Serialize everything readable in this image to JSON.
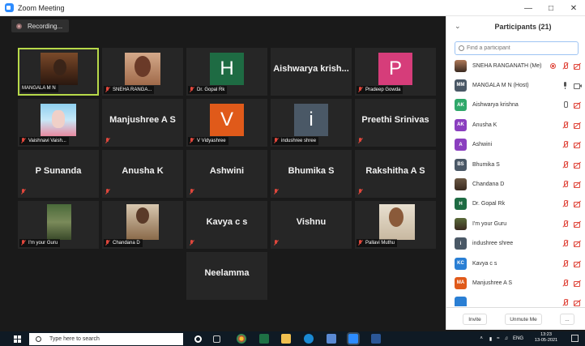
{
  "window": {
    "title": "Zoom Meeting",
    "controls": [
      "—",
      "□",
      "✕"
    ]
  },
  "recording": {
    "label": "Recording..."
  },
  "tiles": [
    {
      "id": "mangala",
      "name": "MANGALA M N",
      "type": "photo",
      "active": true,
      "muted": false
    },
    {
      "id": "sneha",
      "name": "SNEHA RANGA...",
      "type": "photo",
      "muted": true
    },
    {
      "id": "gopal",
      "name": "Dr. Gopal Rk",
      "type": "letter",
      "letter": "H",
      "color": "#1e6b43",
      "muted": true
    },
    {
      "id": "aishwarya",
      "big_name": "Aishwarya krish...",
      "type": "text",
      "muted": false
    },
    {
      "id": "pradeep",
      "name": "Pradeep Gowda",
      "type": "letter",
      "letter": "P",
      "color": "#d63d7a",
      "muted": true
    },
    {
      "id": "vaishnavi",
      "name": "Vaishnavi Vaish...",
      "type": "photo",
      "muted": true
    },
    {
      "id": "manjushree",
      "big_name": "Manjushree A S",
      "type": "text",
      "muted": true
    },
    {
      "id": "vidyashree",
      "name": "V Vidyashree",
      "type": "letter",
      "letter": "V",
      "color": "#e05a1a",
      "muted": true
    },
    {
      "id": "indushree",
      "name": "indushree shree",
      "type": "letter",
      "letter": "i",
      "color": "#4a5866",
      "muted": true
    },
    {
      "id": "preethi",
      "big_name": "Preethi Srinivas",
      "type": "text",
      "muted": true
    },
    {
      "id": "sunanda",
      "big_name": "P Sunanda",
      "type": "text",
      "muted": true
    },
    {
      "id": "anusha",
      "big_name": "Anusha K",
      "type": "text",
      "muted": true
    },
    {
      "id": "ashwini",
      "big_name": "Ashwini",
      "type": "text",
      "muted": true
    },
    {
      "id": "bhumika",
      "big_name": "Bhumika S",
      "type": "text",
      "muted": true
    },
    {
      "id": "rakshitha",
      "big_name": "Rakshitha A S",
      "type": "text",
      "muted": true
    },
    {
      "id": "imyourguru",
      "name": "I'm your Guru",
      "type": "photo",
      "muted": true
    },
    {
      "id": "chandana",
      "name": "Chandana D",
      "type": "photo",
      "muted": true
    },
    {
      "id": "kavya",
      "big_name": "Kavya c s",
      "type": "text",
      "muted": true
    },
    {
      "id": "vishnu",
      "big_name": "Vishnu",
      "type": "text",
      "muted": true
    },
    {
      "id": "pallavi",
      "name": "Pallavi Muthu",
      "type": "photo",
      "muted": true
    },
    {
      "id": "neelamma",
      "big_name": "Neelamma",
      "type": "text",
      "muted": false
    }
  ],
  "participants_panel": {
    "title": "Participants (21)",
    "search_placeholder": "Find a participant",
    "rows": [
      {
        "initials": "",
        "name": "SNEHA RANGANATH (Me)",
        "color": "#b07a5a",
        "photo": true,
        "icons": [
          "rec-dot",
          "mic-red",
          "vid-off"
        ]
      },
      {
        "initials": "MM",
        "name": "MANGALA M N (Host)",
        "color": "#4a5866",
        "icons": [
          "mic-on",
          "vid-on"
        ]
      },
      {
        "initials": "AK",
        "name": "Aishwarya krishna",
        "color": "#2fa86a",
        "icons": [
          "mic-outline",
          "vid-off"
        ]
      },
      {
        "initials": "AK",
        "name": "Anusha K",
        "color": "#8a3fbf",
        "icons": [
          "mic-red",
          "vid-off"
        ]
      },
      {
        "initials": "A",
        "name": "Ashwini",
        "color": "#8a3fbf",
        "icons": [
          "mic-red",
          "vid-off"
        ]
      },
      {
        "initials": "BS",
        "name": "Bhumika S",
        "color": "#4a5866",
        "icons": [
          "mic-red",
          "vid-off"
        ]
      },
      {
        "initials": "",
        "name": "Chandana D",
        "color": "#6b5844",
        "photo": true,
        "icons": [
          "mic-red",
          "vid-off"
        ]
      },
      {
        "initials": "H",
        "name": "Dr. Gopal Rk",
        "color": "#1e6b43",
        "icons": [
          "mic-red",
          "vid-off"
        ]
      },
      {
        "initials": "",
        "name": "I'm your Guru",
        "color": "#5a6b3a",
        "photo": true,
        "icons": [
          "mic-red",
          "vid-off"
        ]
      },
      {
        "initials": "i",
        "name": "indushree shree",
        "color": "#4a5866",
        "icons": [
          "mic-red",
          "vid-off"
        ]
      },
      {
        "initials": "KC",
        "name": "Kavya c s",
        "color": "#2a7fd4",
        "icons": [
          "mic-red",
          "vid-off"
        ]
      },
      {
        "initials": "MA",
        "name": "Manjushree A S",
        "color": "#e05a1a",
        "icons": [
          "mic-red",
          "vid-off"
        ]
      },
      {
        "initials": "",
        "name": "",
        "color": "#2a7fd4",
        "icons": [
          "mic-red",
          "vid-off"
        ]
      }
    ],
    "footer": {
      "invite": "Invite",
      "unmute_me": "Unmute Me",
      "more": "..."
    }
  },
  "taskbar": {
    "search_placeholder": "Type here to search",
    "tray_lang": "ENG",
    "time": "13:23",
    "date": "13-05-2021"
  }
}
